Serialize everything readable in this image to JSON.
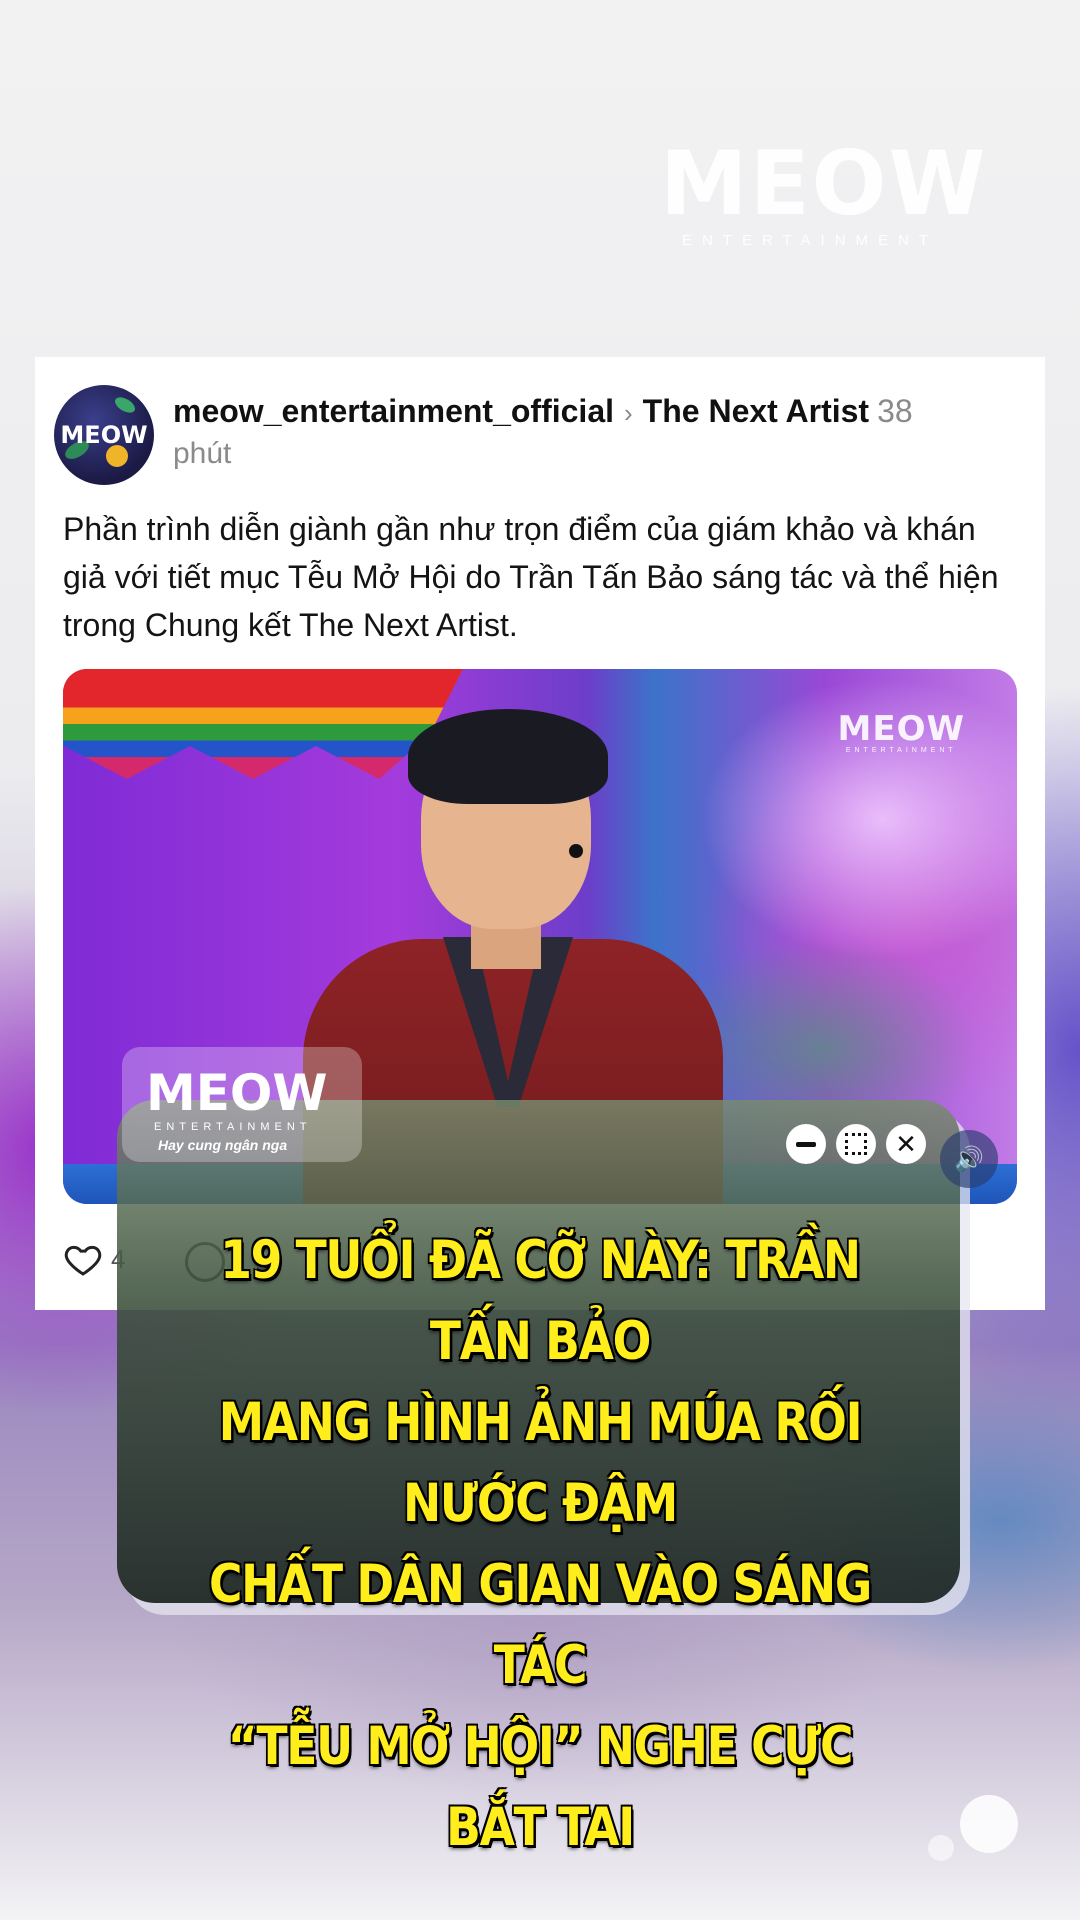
{
  "brand": {
    "logo_word": "MEOW",
    "logo_sub": "ENTERTAINMENT"
  },
  "post": {
    "avatar_text": "MEOW",
    "username": "meow_entertainment_official",
    "channel": "The Next Artist",
    "time_number": "38",
    "time_unit": "phút",
    "caption": "Phần trình diễn giành gần như trọn điểm của giám khảo và khán giả với tiết mục Tễu Mở Hội do Trần Tấn Bảo sáng tác và thể hiện trong Chung kết The Next Artist.",
    "like_count": "4"
  },
  "video": {
    "logo_word": "MEOW",
    "logo_sub": "ENTERTAINMENT"
  },
  "overlay": {
    "logo_word": "MEOW",
    "logo_sub": "ENTERTAINMENT",
    "lyric": "Hay cung ngân nga"
  },
  "headline": {
    "line1": "19 TUỔI ĐÃ CỠ NÀY: TRẦN TẤN BẢO",
    "line2": "MANG HÌNH ẢNH MÚA RỐI NƯỚC ĐẬM",
    "line3": "CHẤT DÂN GIAN VÀO SÁNG TÁC",
    "line4": "“TỄU MỞ HỘI” NGHE CỰC BẮT TAI",
    "text_color": "#ffee1c"
  },
  "icons": {
    "heart": "heart-icon",
    "comment": "comment-icon",
    "minimize": "minimize-icon",
    "maximize": "maximize-icon",
    "close": "close-icon",
    "sound": "speaker-icon",
    "chevron": "chevron-right-icon"
  }
}
